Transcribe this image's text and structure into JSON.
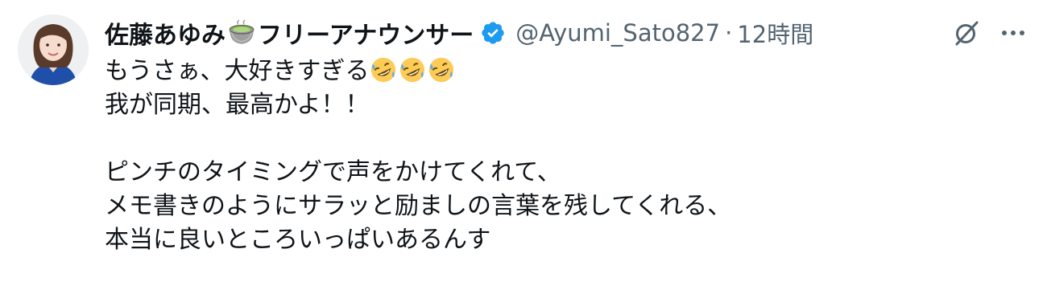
{
  "tweet": {
    "author": {
      "name_part1": "佐藤あゆみ",
      "name_emoji": "matcha-tea-emoji",
      "name_part2": "フリーアナウンサー",
      "verified": true,
      "handle": "@Ayumi_Sato827",
      "separator": "·",
      "time": "12時間"
    },
    "body": {
      "line1": "もうさぁ、大好きすぎる",
      "line1_emojis": [
        "rolling-on-floor-laughing-emoji",
        "rolling-on-floor-laughing-emoji",
        "rolling-on-floor-laughing-emoji"
      ],
      "line2": "我が同期、最高かよ！！",
      "line3": "",
      "line4": "ピンチのタイミングで声をかけてくれて、",
      "line5": "メモ書きのようにサラッと励ましの言葉を残してくれる、",
      "line6": "本当に良いところいっぱいあるんす"
    },
    "actions": {
      "grok_icon": "grok-icon",
      "more_icon": "more-options-icon"
    },
    "colors": {
      "text": "#0f1419",
      "secondary": "#536471",
      "verified": "#1d9bf0"
    }
  }
}
